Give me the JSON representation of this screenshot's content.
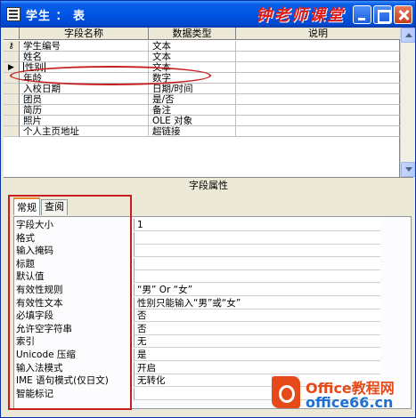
{
  "window": {
    "title": "学生 ： 表",
    "watermark_title": "钟老师课堂"
  },
  "grid": {
    "columns": {
      "name": "字段名称",
      "type": "数据类型",
      "desc": "说明"
    },
    "rows": [
      {
        "marker": "key",
        "name": "学生编号",
        "type": "文本",
        "desc": ""
      },
      {
        "marker": "",
        "name": "姓名",
        "type": "文本",
        "desc": ""
      },
      {
        "marker": "current",
        "name": "性别",
        "type": "文本",
        "desc": ""
      },
      {
        "marker": "",
        "name": "年龄",
        "type": "数字",
        "desc": ""
      },
      {
        "marker": "",
        "name": "入校日期",
        "type": "日期/时间",
        "desc": ""
      },
      {
        "marker": "",
        "name": "团员",
        "type": "是/否",
        "desc": ""
      },
      {
        "marker": "",
        "name": "简历",
        "type": "备注",
        "desc": ""
      },
      {
        "marker": "",
        "name": "照片",
        "type": "OLE 对象",
        "desc": ""
      },
      {
        "marker": "",
        "name": "个人主页地址",
        "type": "超链接",
        "desc": ""
      }
    ]
  },
  "properties": {
    "title": "字段属性",
    "tabs": {
      "general": "常规",
      "lookup": "查阅"
    },
    "items": [
      {
        "label": "字段大小",
        "value": "1"
      },
      {
        "label": "格式",
        "value": ""
      },
      {
        "label": "输入掩码",
        "value": ""
      },
      {
        "label": "标题",
        "value": ""
      },
      {
        "label": "默认值",
        "value": ""
      },
      {
        "label": "有效性规则",
        "value": "“男” Or “女”"
      },
      {
        "label": "有效性文本",
        "value": "性别只能输入“男”或“女”"
      },
      {
        "label": "必填字段",
        "value": "否"
      },
      {
        "label": "允许空字符串",
        "value": "否"
      },
      {
        "label": "索引",
        "value": "无"
      },
      {
        "label": "Unicode 压缩",
        "value": "是"
      },
      {
        "label": "输入法模式",
        "value": "开启"
      },
      {
        "label": "IME 语句模式(仅日文)",
        "value": "无转化"
      },
      {
        "label": "智能标记",
        "value": ""
      }
    ]
  },
  "logo": {
    "line1": "Office教程网",
    "line2": "office66.cn"
  },
  "colors": {
    "title_bar": "#0055e5",
    "highlight": "#c81e1e",
    "logo_orange": "#e64a19",
    "logo_blue": "#1f6fcf"
  }
}
